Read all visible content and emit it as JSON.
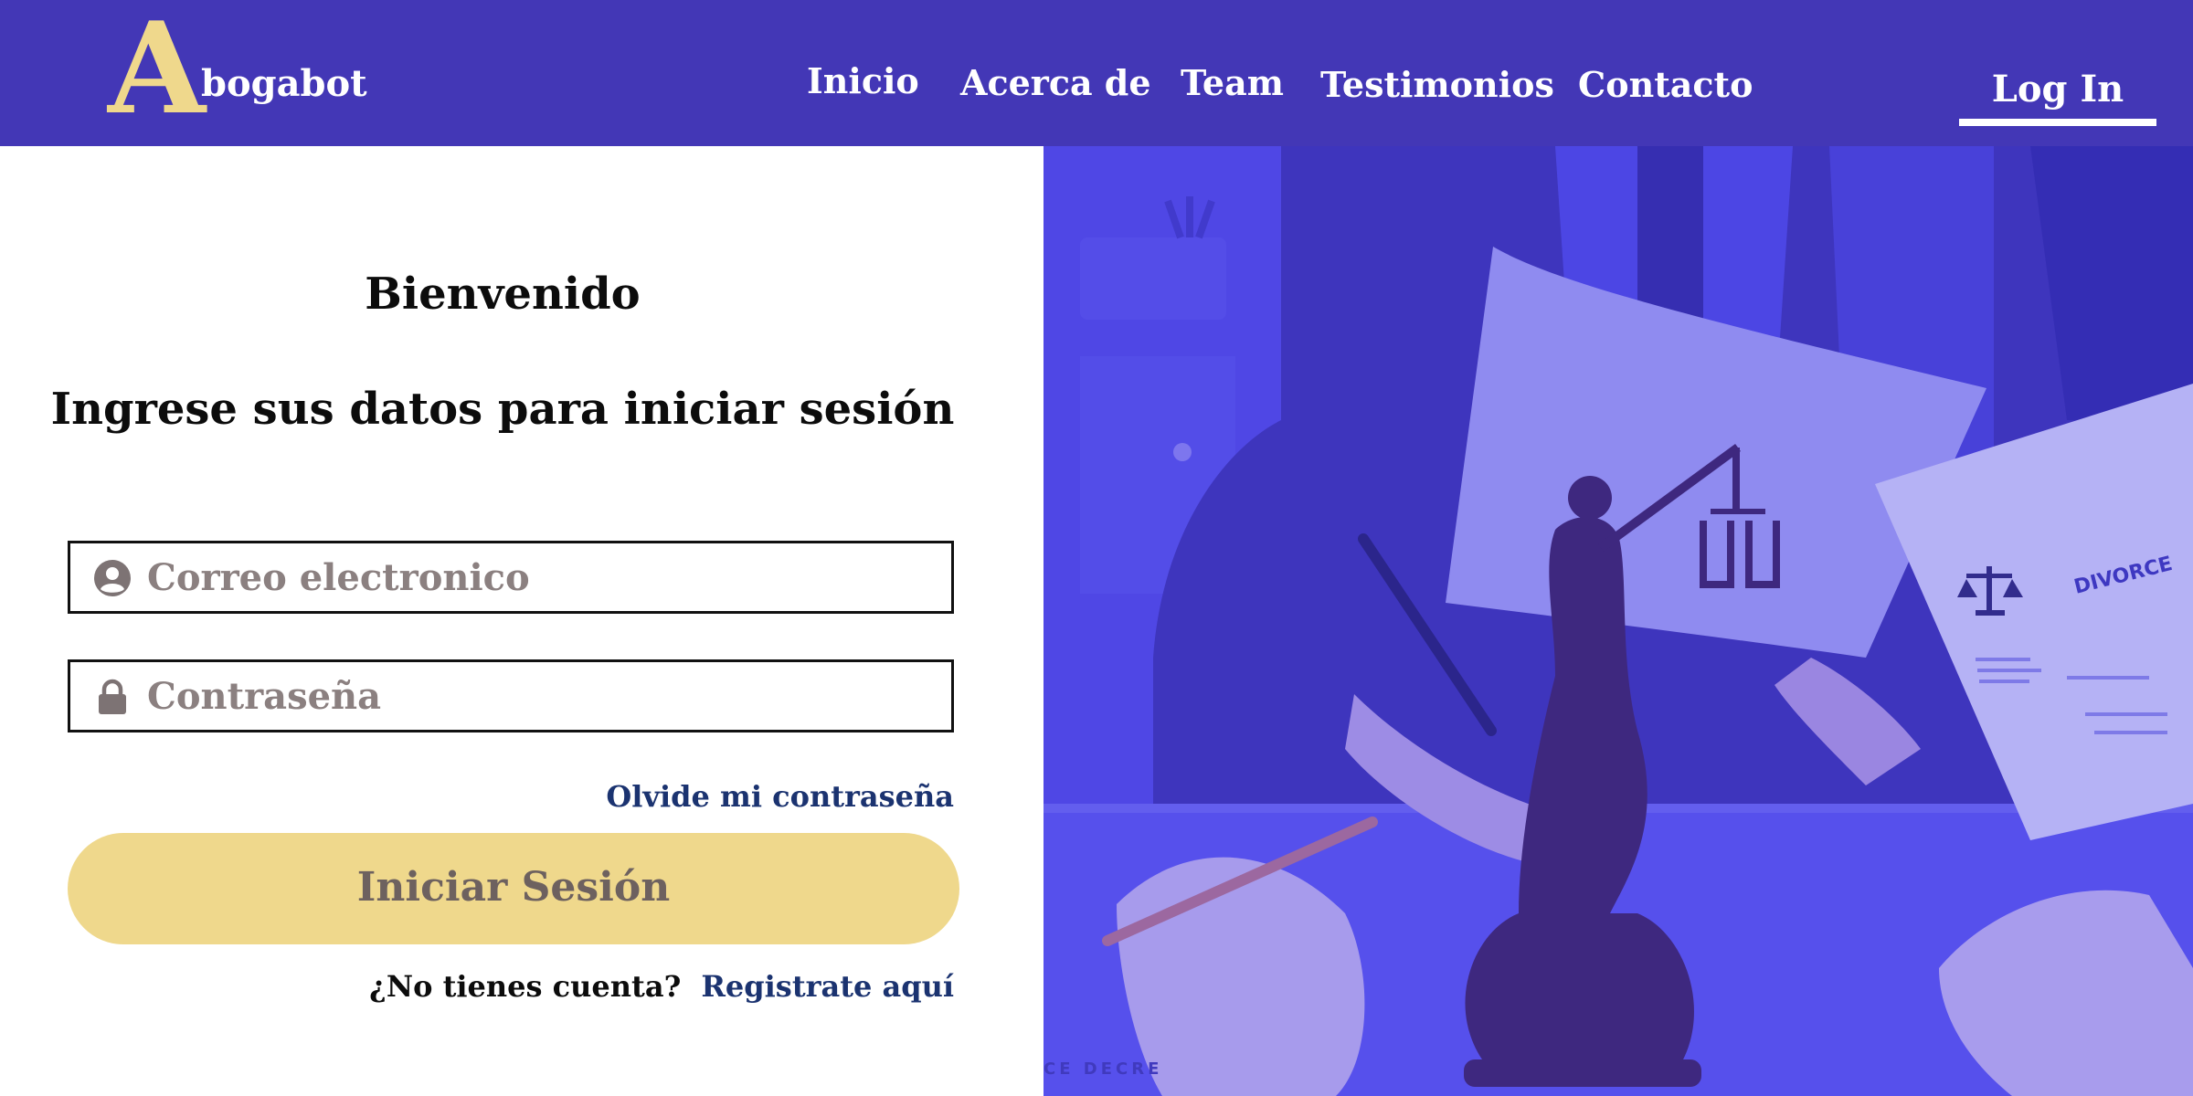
{
  "brand": {
    "letter": "A",
    "name": "bogabot",
    "accent_color": "#efd88c",
    "header_color": "#4337b6"
  },
  "nav": {
    "items": [
      {
        "label": "Inicio"
      },
      {
        "label": "Acerca de"
      },
      {
        "label": "Team"
      },
      {
        "label": "Testimonios"
      },
      {
        "label": "Contacto"
      }
    ],
    "login_label": "Log In"
  },
  "login_form": {
    "title": "Bienvenido",
    "subtitle": "Ingrese sus datos para iniciar sesión",
    "email": {
      "placeholder": "Correo electronico",
      "value": "",
      "icon": "user-circle-icon"
    },
    "password": {
      "placeholder": "Contraseña",
      "value": "",
      "icon": "lock-icon"
    },
    "forgot_label": "Olvide mi contraseña",
    "submit_label": "Iniciar Sesión",
    "submit_color": "#efd88c",
    "signup_question": "¿No tienes cuenta?",
    "signup_link": "Registrate aquí",
    "link_color": "#1b3370"
  },
  "hero": {
    "overlay_color": "#4b44e3",
    "document_text_1": "DIVORCE",
    "document_text_2": "CE DECRE"
  }
}
